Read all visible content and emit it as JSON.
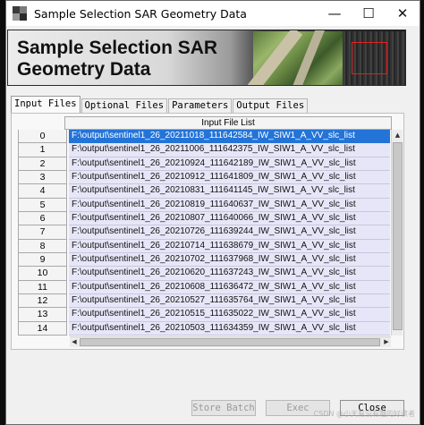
{
  "window": {
    "title": "Sample Selection SAR Geometry Data",
    "controls": {
      "minimize": "—",
      "maximize": "☐",
      "close": "✕"
    }
  },
  "banner": {
    "title_line1": "Sample Selection SAR",
    "title_line2": "Geometry Data"
  },
  "tabs": [
    {
      "label": "Input Files",
      "active": true
    },
    {
      "label": "Optional Files",
      "active": false
    },
    {
      "label": "Parameters",
      "active": false
    },
    {
      "label": "Output Files",
      "active": false
    }
  ],
  "table": {
    "header": "Input File List",
    "rows": [
      {
        "index": "0",
        "file": "F:\\output\\sentinel1_26_20211018_111642584_IW_SIW1_A_VV_slc_list",
        "selected": true
      },
      {
        "index": "1",
        "file": "F:\\output\\sentinel1_26_20211006_111642375_IW_SIW1_A_VV_slc_list"
      },
      {
        "index": "2",
        "file": "F:\\output\\sentinel1_26_20210924_111642189_IW_SIW1_A_VV_slc_list"
      },
      {
        "index": "3",
        "file": "F:\\output\\sentinel1_26_20210912_111641809_IW_SIW1_A_VV_slc_list"
      },
      {
        "index": "4",
        "file": "F:\\output\\sentinel1_26_20210831_111641145_IW_SIW1_A_VV_slc_list"
      },
      {
        "index": "5",
        "file": "F:\\output\\sentinel1_26_20210819_111640637_IW_SIW1_A_VV_slc_list"
      },
      {
        "index": "6",
        "file": "F:\\output\\sentinel1_26_20210807_111640066_IW_SIW1_A_VV_slc_list"
      },
      {
        "index": "7",
        "file": "F:\\output\\sentinel1_26_20210726_111639244_IW_SIW1_A_VV_slc_list"
      },
      {
        "index": "8",
        "file": "F:\\output\\sentinel1_26_20210714_111638679_IW_SIW1_A_VV_slc_list"
      },
      {
        "index": "9",
        "file": "F:\\output\\sentinel1_26_20210702_111637968_IW_SIW1_A_VV_slc_list"
      },
      {
        "index": "10",
        "file": "F:\\output\\sentinel1_26_20210620_111637243_IW_SIW1_A_VV_slc_list"
      },
      {
        "index": "11",
        "file": "F:\\output\\sentinel1_26_20210608_111636472_IW_SIW1_A_VV_slc_list"
      },
      {
        "index": "12",
        "file": "F:\\output\\sentinel1_26_20210527_111635764_IW_SIW1_A_VV_slc_list"
      },
      {
        "index": "13",
        "file": "F:\\output\\sentinel1_26_20210515_111635022_IW_SIW1_A_VV_slc_list"
      },
      {
        "index": "14",
        "file": "F:\\output\\sentinel1_26_20210503_111634359_IW_SIW1_A_VV_slc_list"
      }
    ]
  },
  "buttons": {
    "store_batch": "Store Batch",
    "exec": "Exec",
    "close": "Close"
  },
  "watermark": "CSDN @小天有没有趣的好读者",
  "colors": {
    "selected_row": "#2474d8",
    "row_bg": "#e6e6f8"
  }
}
